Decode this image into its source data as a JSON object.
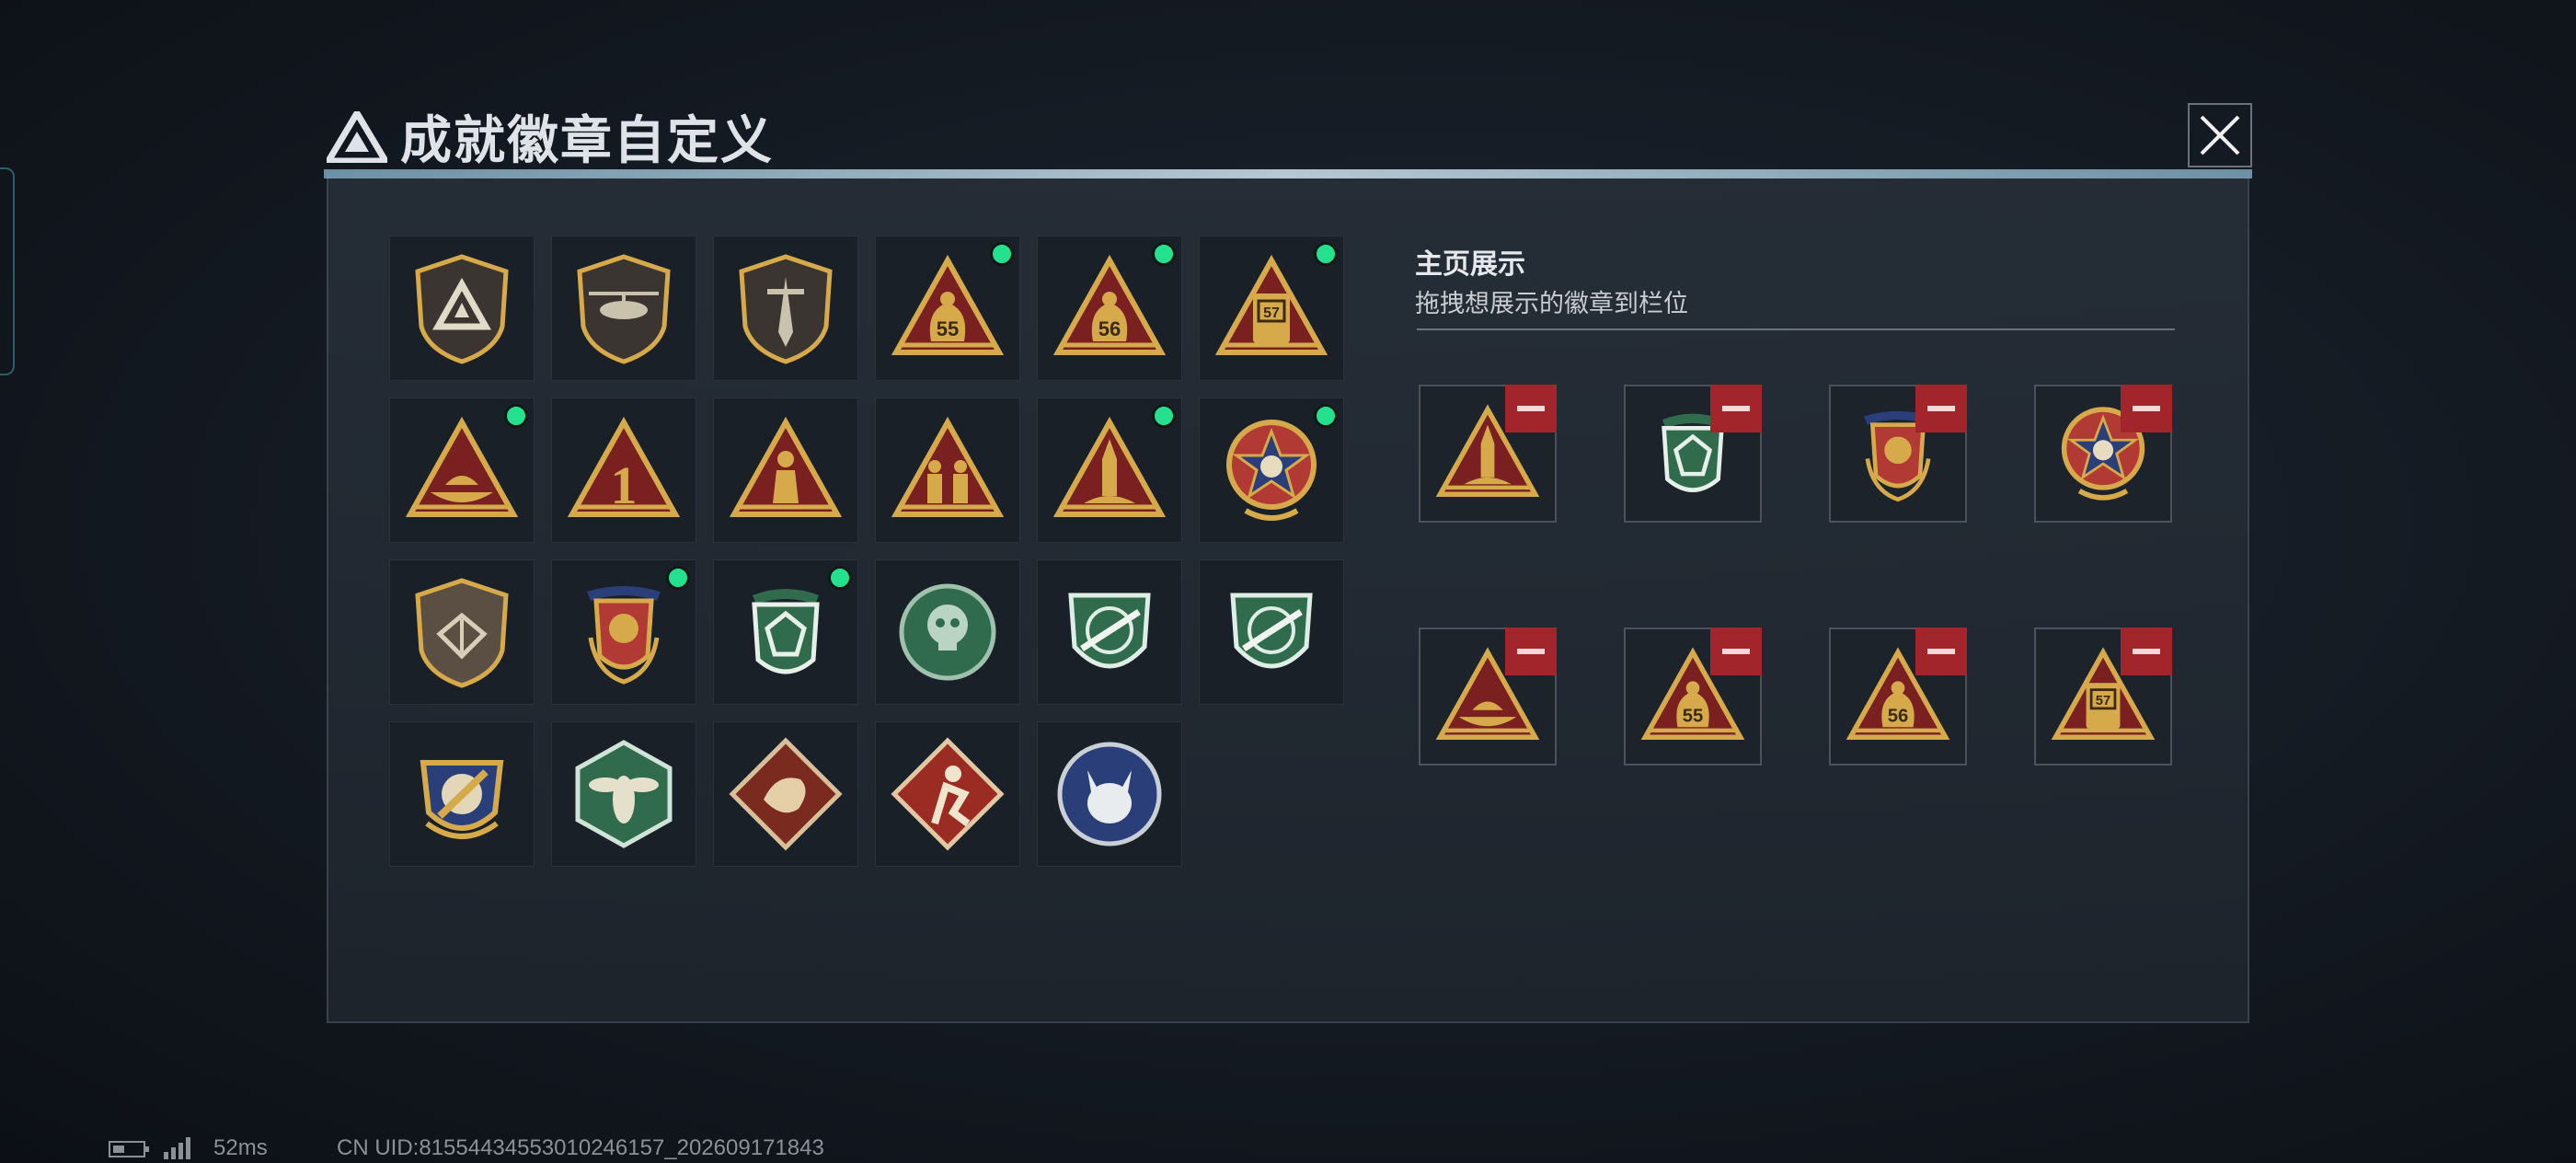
{
  "header": {
    "title": "成就徽章自定义"
  },
  "colors": {
    "accent": "#25e08d",
    "remove": "#a3252c",
    "gold": "#d6a94a",
    "green": "#2f6b4c",
    "red": "#7a2020"
  },
  "collection": [
    {
      "icon": "logo-shield-badge",
      "equipped": false
    },
    {
      "icon": "helicopter-shield-badge",
      "equipped": false
    },
    {
      "icon": "dagger-shield-badge",
      "equipped": false
    },
    {
      "icon": "bag-55-badge",
      "label": "55",
      "equipped": true
    },
    {
      "icon": "bag-56-badge",
      "label": "56",
      "equipped": true
    },
    {
      "icon": "crate-57-badge",
      "label": "57",
      "equipped": true
    },
    {
      "icon": "boat-badge",
      "equipped": true
    },
    {
      "icon": "number-one-badge",
      "label": "1",
      "equipped": false
    },
    {
      "icon": "soldier-badge",
      "equipped": false
    },
    {
      "icon": "squad-badge",
      "equipped": false
    },
    {
      "icon": "rocket-badge",
      "equipped": true
    },
    {
      "icon": "skull-star-medal-badge",
      "equipped": true
    },
    {
      "icon": "wing-shield-badge",
      "equipped": false
    },
    {
      "icon": "banner-laurel-badge",
      "equipped": true
    },
    {
      "icon": "green-gem-badge",
      "equipped": true
    },
    {
      "icon": "green-skull-badge",
      "equipped": false
    },
    {
      "icon": "green-rifle-badge",
      "equipped": false
    },
    {
      "icon": "green-rifle-badge-2",
      "equipped": false
    },
    {
      "icon": "blue-crest-badge",
      "equipped": false
    },
    {
      "icon": "hornet-hex-badge",
      "equipped": false
    },
    {
      "icon": "dragon-diamond-badge",
      "equipped": false
    },
    {
      "icon": "runner-diamond-badge",
      "equipped": false
    },
    {
      "icon": "lynx-round-badge",
      "equipped": false
    }
  ],
  "showcase": {
    "title": "主页展示",
    "subtitle": "拖拽想展示的徽章到栏位",
    "slots": [
      {
        "icon": "rocket-badge"
      },
      {
        "icon": "green-gem-badge"
      },
      {
        "icon": "banner-laurel-badge"
      },
      {
        "icon": "skull-star-medal-badge"
      },
      {
        "icon": "boat-badge"
      },
      {
        "icon": "bag-55-badge",
        "label": "55"
      },
      {
        "icon": "bag-56-badge",
        "label": "56"
      },
      {
        "icon": "crate-57-badge",
        "label": "57"
      }
    ]
  },
  "status": {
    "ping": "52ms",
    "uid": "CN UID:8155443455301024615​7_202609171843"
  }
}
